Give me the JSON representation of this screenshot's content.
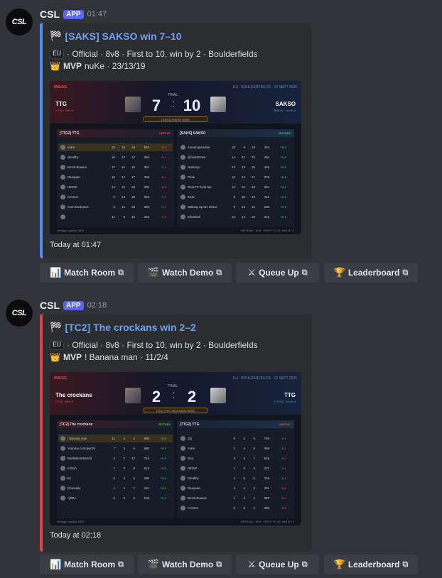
{
  "messages": [
    {
      "author": "CSL",
      "badge": "APP",
      "time": "01:47",
      "embed_title": "[SAKS] SAKSO win 7–10",
      "region": "EU",
      "meta": "· Official · 8v8 · First to 10, win by 2 · Boulderfields",
      "mvp_label": "MVP",
      "mvp_value": "nuKe · 23/13/19",
      "footer": "Today at 01:47",
      "card": {
        "header_left": "8V8.GG",
        "header_right": "EU · BOULDERFIELDS · 12 SEPT 2025",
        "final_label": "FINAL",
        "left_team": "TTG",
        "left_sub": "[TTG] · RED 8",
        "right_team": "SAKSO",
        "right_sub": "[SAKS] · BLUE 8",
        "score_left": "7",
        "score_right": "10",
        "banner": "[SAKS] SAKSO WINS",
        "left_table_title": "[TTG2] TTG",
        "left_result": "DEFEAT",
        "right_table_title": "[SAKS] SAKSO",
        "right_result": "VICTORY",
        "left_players": [
          [
            "nuKe",
            "23",
            "13",
            "19",
            "633",
            "-0.1"
          ],
          [
            "Stealthy",
            "16",
            "13",
            "13",
            "382",
            "-0.1"
          ],
          [
            "Brock Bowers",
            "11",
            "15",
            "15",
            "397",
            "-0.1"
          ],
          [
            "Daequan",
            "10",
            "12",
            "17",
            "359",
            "-0.1"
          ],
          [
            "HEINZ",
            "12",
            "13",
            "18",
            "335",
            "-0.2"
          ],
          [
            "Crismer",
            "9",
            "13",
            "18",
            "326",
            "-0.2"
          ],
          [
            "mom backpack",
            "9",
            "12",
            "18",
            "306",
            "-0.2"
          ],
          [
            "",
            "11",
            "9",
            "16",
            "292",
            "-0.2"
          ]
        ],
        "right_players": [
          [
            "Alonelnparadise",
            "23",
            "9",
            "18",
            "454",
            "+0.2"
          ],
          [
            "@mak3Draw",
            "14",
            "11",
            "23",
            "484",
            "+0.2"
          ],
          [
            "Nortenyo",
            "13",
            "15",
            "15",
            "429",
            "+0.2"
          ],
          [
            "Pride",
            "10",
            "12",
            "21",
            "375",
            "+0.1"
          ],
          [
            "DAHAT! feyla fan",
            "12",
            "12",
            "19",
            "364",
            "+0.1"
          ],
          [
            "223x",
            "8",
            "15",
            "18",
            "311",
            "+0.1"
          ],
          [
            "Waking Up the Grave",
            "9",
            "13",
            "12",
            "230",
            "+0.1"
          ],
          [
            "Elizabeth",
            "10",
            "14",
            "10",
            "215",
            "+0.1"
          ]
        ],
        "footer_left": "#8v8gg matchid 2875",
        "footer_right": "OFFICIAL · 8V8 · FIRST TO 10, WIN BY 2"
      }
    },
    {
      "author": "CSL",
      "badge": "APP",
      "time": "02:18",
      "embed_title": "[TC2] The crockans win 2–2",
      "region": "EU",
      "meta": "· Official · 8v8 · First to 10, win by 2 · Boulderfields",
      "mvp_label": "MVP",
      "mvp_value": "! Banana man · 11/2/4",
      "footer": "Today at 02:18",
      "card": {
        "header_left": "8V8.GG",
        "header_right": "EU · BOULDERFIELDS · 12 SEPT 2025",
        "final_label": "FINAL",
        "left_team": "The crockans",
        "left_sub": "[TC2] · RED 8",
        "right_team": "TTG",
        "right_sub": "[TTG2] · BLUE 8",
        "score_left": "2",
        "score_right": "2",
        "banner": "[TC2] THE CROCKANS WINS",
        "left_table_title": "[TC2] The crockans",
        "left_result": "VICTORY",
        "right_table_title": "[TTG2] TTG",
        "right_result": "DEFEAT",
        "left_players": [
          [
            "! Banana man",
            "11",
            "2",
            "4",
            "900",
            "+0.2"
          ],
          [
            "Youtube.com/qwr28",
            "7",
            "3",
            "6",
            "880",
            "+0.2"
          ],
          [
            "BattleBeanBandit",
            "4",
            "3",
            "12",
            "718",
            "+0.1"
          ],
          [
            "milosh",
            "1",
            "3",
            "8",
            "614",
            "+0.1"
          ],
          [
            "Ev",
            "3",
            "3",
            "5",
            "480",
            "+0.1"
          ],
          [
            "[Canada]",
            "4",
            "4",
            "7",
            "451",
            "+0.1"
          ],
          [
            "-||R0A",
            "0",
            "3",
            "5",
            "158",
            "+0.1"
          ]
        ],
        "right_players": [
          [
            "Zip",
            "9",
            "2",
            "6",
            "749",
            "-0.1"
          ],
          [
            "nuKe",
            "2",
            "4",
            "9",
            "659",
            "-0.1"
          ],
          [
            "Daq",
            "4",
            "3",
            "7",
            "545",
            "-0.1"
          ],
          [
            "HEINZ",
            "1",
            "4",
            "4",
            "431",
            "-0.1"
          ],
          [
            "Stealthy",
            "1",
            "5",
            "5",
            "415",
            "-0.1"
          ],
          [
            "Daequan",
            "4",
            "4",
            "2",
            "291",
            "-0.1"
          ],
          [
            "Brock Bowers",
            "1",
            "4",
            "4",
            "352",
            "-0.1"
          ],
          [
            "Crismer",
            "0",
            "5",
            "4",
            "295",
            "-0.2"
          ]
        ],
        "footer_left": "#8v8gg matchid 2876",
        "footer_right": "OFFICIAL · 8V8 · FIRST TO 10, WIN BY 2"
      }
    }
  ],
  "buttons": [
    {
      "label": "Match Room",
      "icon": "bar-chart-icon"
    },
    {
      "label": "Watch Demo",
      "icon": "clapper-icon"
    },
    {
      "label": "Queue Up",
      "icon": "crossed-swords-icon"
    },
    {
      "label": "Leaderboard",
      "icon": "trophy-icon"
    }
  ],
  "colors": {
    "blurple": "#5865f2",
    "blue_accent": "#4f8cf7",
    "red_accent": "#e34248"
  }
}
